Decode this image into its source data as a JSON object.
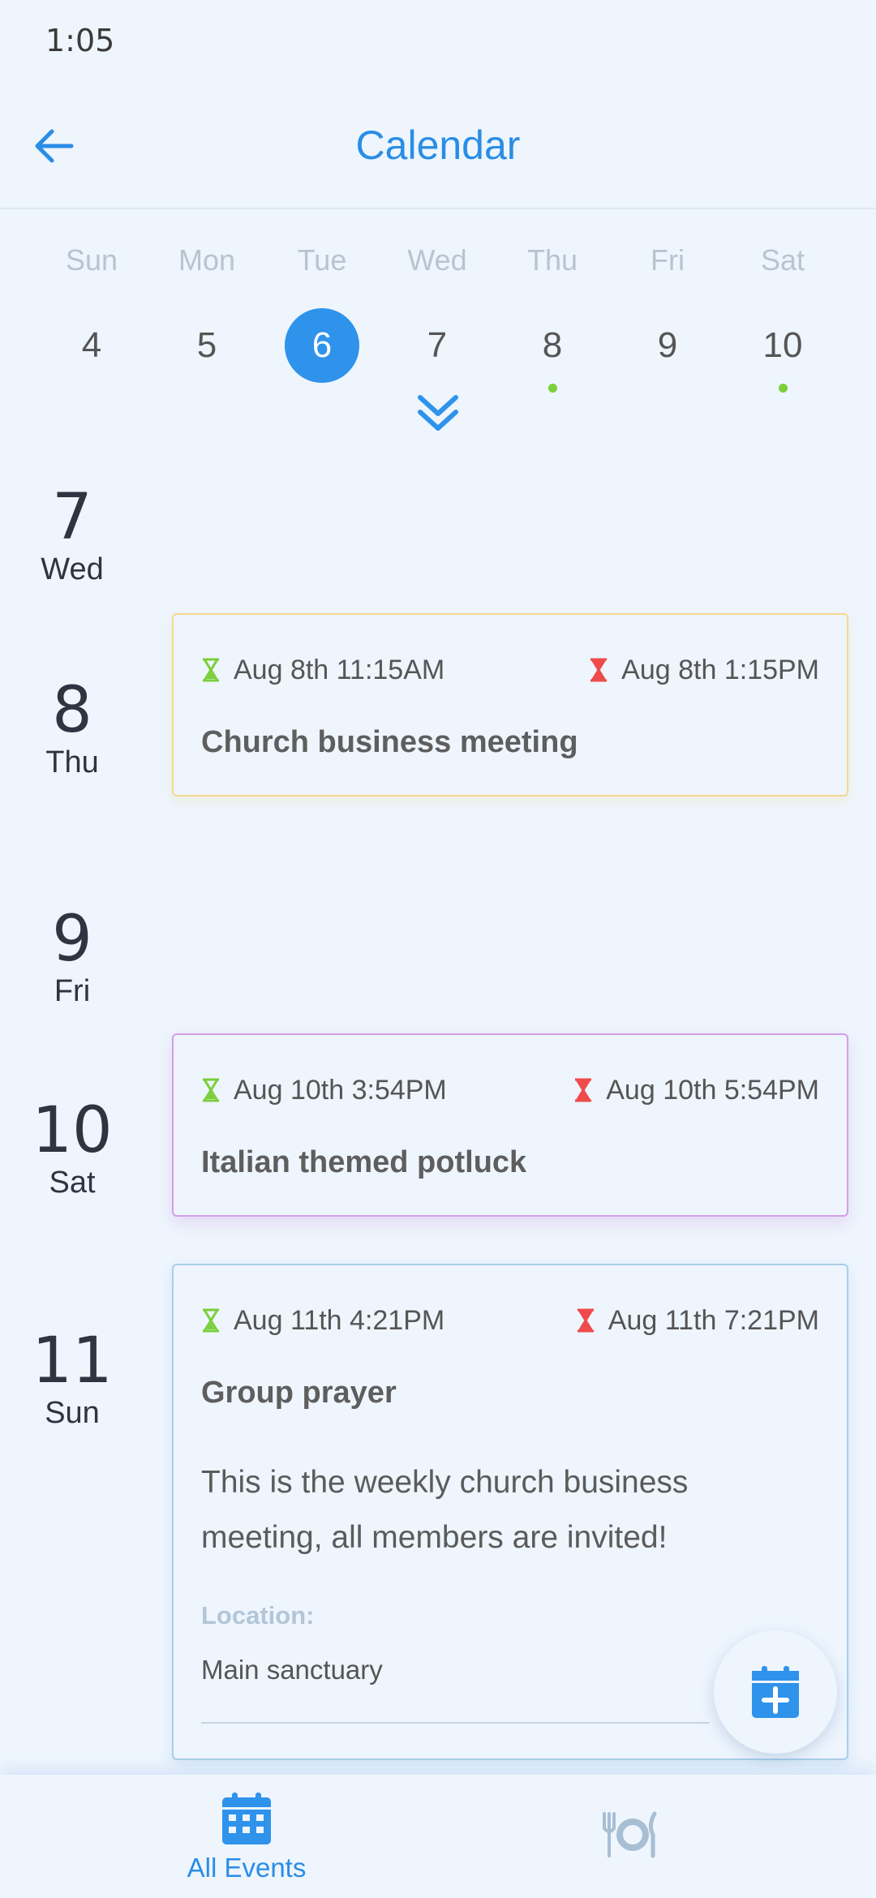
{
  "status_bar": {
    "time": "1:05"
  },
  "app_bar": {
    "title": "Calendar",
    "back_icon": "arrow-left-icon"
  },
  "week": {
    "days_of_week": [
      "Sun",
      "Mon",
      "Tue",
      "Wed",
      "Thu",
      "Fri",
      "Sat"
    ],
    "dates": [
      {
        "label": "4",
        "selected": false,
        "has_event": false
      },
      {
        "label": "5",
        "selected": false,
        "has_event": false
      },
      {
        "label": "6",
        "selected": true,
        "has_event": false
      },
      {
        "label": "7",
        "selected": false,
        "has_event": false
      },
      {
        "label": "8",
        "selected": false,
        "has_event": true
      },
      {
        "label": "9",
        "selected": false,
        "has_event": false
      },
      {
        "label": "10",
        "selected": false,
        "has_event": true
      }
    ],
    "expand_icon": "double-chevron-down-icon"
  },
  "agenda": {
    "days": [
      {
        "num": "7",
        "dow": "Wed"
      },
      {
        "num": "8",
        "dow": "Thu"
      },
      {
        "num": "9",
        "dow": "Fri"
      },
      {
        "num": "10",
        "dow": "Sat"
      },
      {
        "num": "11",
        "dow": "Sun"
      }
    ],
    "events": [
      {
        "start": "Aug 8th 11:15AM",
        "end": "Aug 8th 1:15PM",
        "title": "Church business meeting",
        "border_color": "#f3d98d"
      },
      {
        "start": "Aug 10th 3:54PM",
        "end": "Aug 10th 5:54PM",
        "title": "Italian themed potluck",
        "border_color": "#d49ee6"
      },
      {
        "start": "Aug 11th 4:21PM",
        "end": "Aug 11th 7:21PM",
        "title": "Group prayer",
        "description": "This is the weekly church business meeting, all members are invited!",
        "location_label": "Location:",
        "location": "Main sanctuary",
        "border_color": "#a9cfe9"
      }
    ]
  },
  "fab": {
    "icon": "calendar-add-icon"
  },
  "bottom_nav": {
    "items": [
      {
        "label": "All Events",
        "icon": "calendar-grid-icon",
        "active": true
      },
      {
        "label": "",
        "icon": "dining-plate-icon",
        "active": false
      }
    ]
  },
  "colors": {
    "accent": "#2f93ec",
    "start_icon": "#7bcf3a",
    "end_icon": "#ef4b4b",
    "background": "#eef5fd"
  }
}
